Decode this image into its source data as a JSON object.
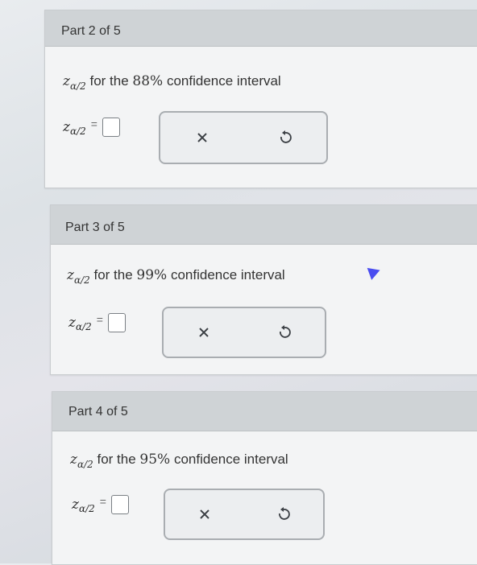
{
  "parts": [
    {
      "label": "Part 2 of 5",
      "var": "z",
      "sub": "α/2",
      "question_mid": "for the",
      "percent": "88%",
      "question_end": "confidence interval",
      "eq_var": "z",
      "eq_sub": "α/2",
      "eq_sign": "="
    },
    {
      "label": "Part 3 of 5",
      "var": "z",
      "sub": "α/2",
      "question_mid": "for the",
      "percent": "99%",
      "question_end": "confidence interval",
      "eq_var": "z",
      "eq_sub": "α/2",
      "eq_sign": "="
    },
    {
      "label": "Part 4 of 5",
      "var": "z",
      "sub": "α/2",
      "question_mid": "for the",
      "percent": "95%",
      "question_end": "confidence interval",
      "eq_var": "z",
      "eq_sub": "α/2",
      "eq_sign": "="
    }
  ],
  "icons": {
    "clear": "x-icon",
    "reset": "undo-icon"
  },
  "colors": {
    "header": "#cfd3d6",
    "card": "#f3f4f5",
    "cursor": "#4a4df0"
  }
}
